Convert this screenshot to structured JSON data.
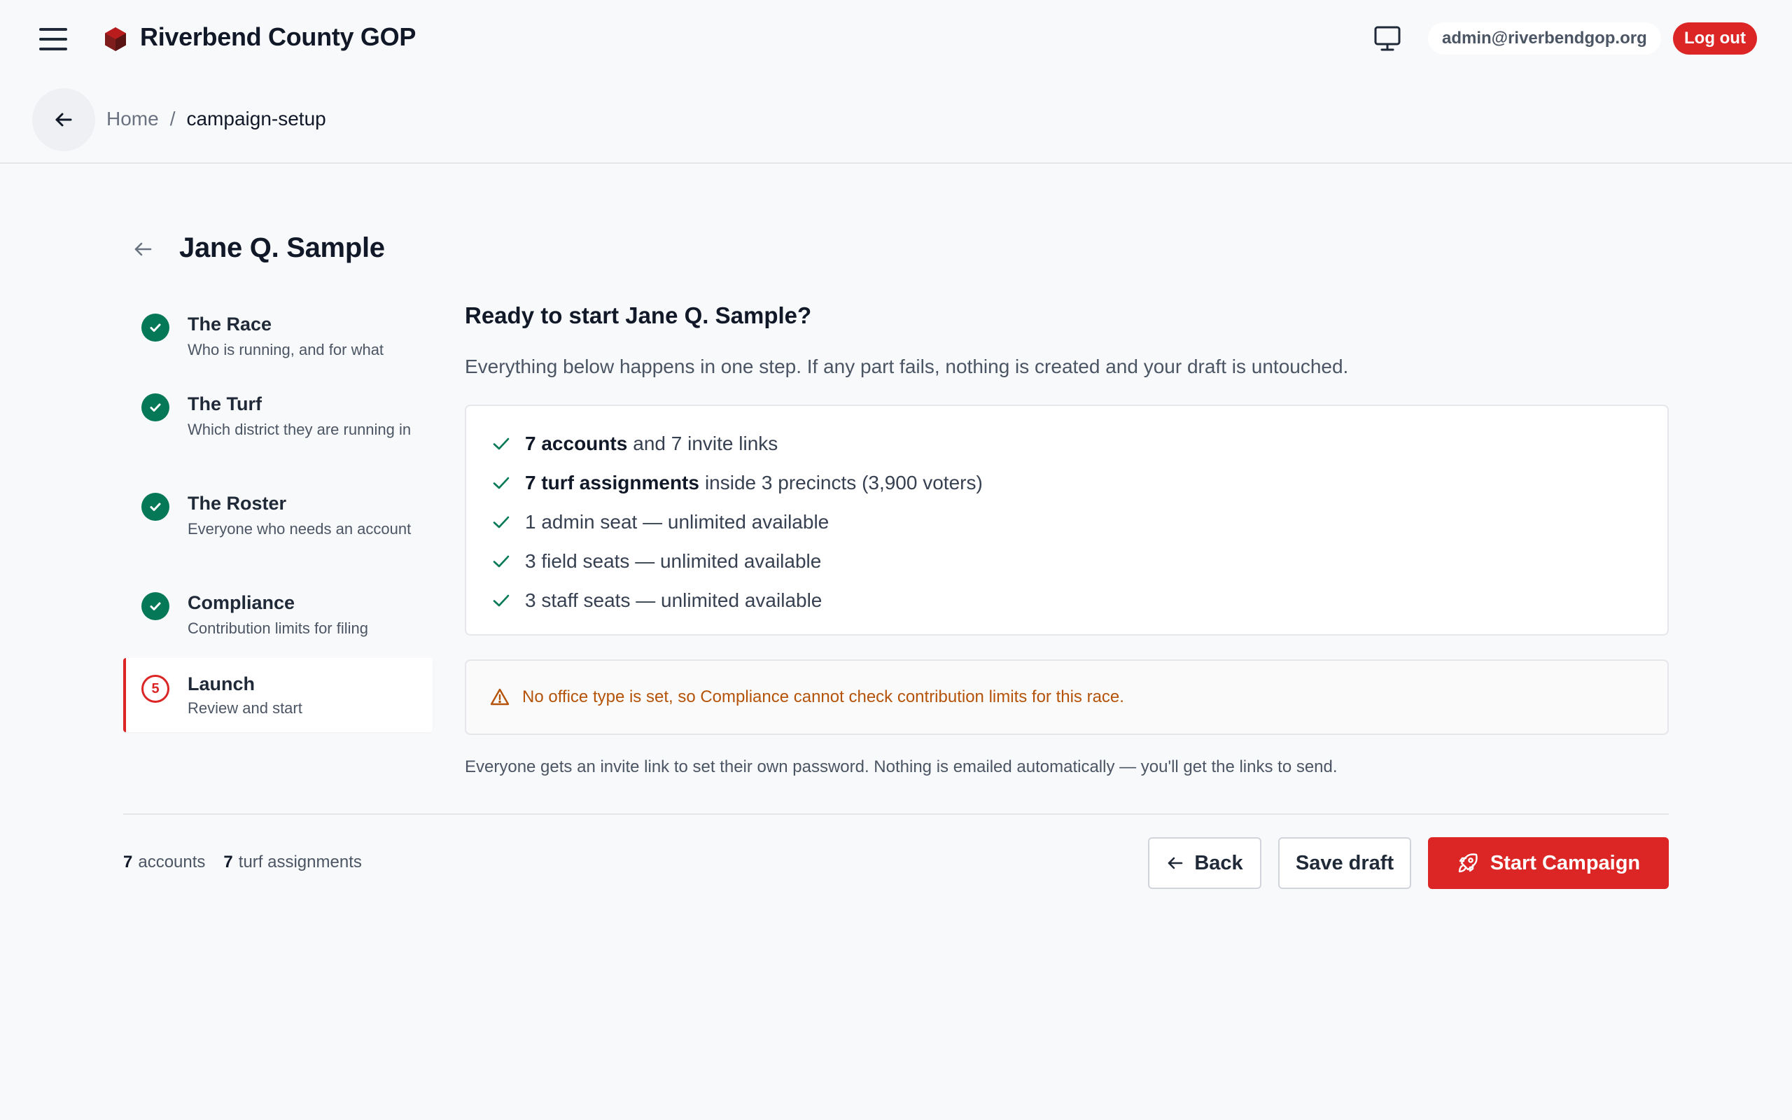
{
  "header": {
    "brand": "Riverbend County GOP",
    "user_email": "admin@riverbendgop.org",
    "logout_label": "Log out",
    "icons": [
      "menu-icon",
      "logo-icon",
      "monitor-icon"
    ]
  },
  "breadcrumb": {
    "home": "Home",
    "separator": "/",
    "current": "campaign-setup"
  },
  "page": {
    "title": "Jane Q. Sample"
  },
  "steps": [
    {
      "number": "1",
      "title": "The Race",
      "subtitle": "Who is running, and for what",
      "status": "complete"
    },
    {
      "number": "2",
      "title": "The Turf",
      "subtitle": "Which district they are running in",
      "status": "complete"
    },
    {
      "number": "3",
      "title": "The Roster",
      "subtitle": "Everyone who needs an account",
      "status": "complete"
    },
    {
      "number": "4",
      "title": "Compliance",
      "subtitle": "Contribution limits for filing",
      "status": "complete"
    },
    {
      "number": "5",
      "title": "Launch",
      "subtitle": "Review and start",
      "status": "current"
    }
  ],
  "launch": {
    "heading": "Ready to start Jane Q. Sample?",
    "lead": "Everything below happens in one step. If any part fails, nothing is created and your draft is untouched.",
    "summary": [
      {
        "bold": "7 accounts",
        "text": "and 7 invite links"
      },
      {
        "bold": "7 turf assignments",
        "text": "inside 3 precincts (3,900 voters)"
      },
      {
        "bold": "",
        "text": "1 admin seat — unlimited available"
      },
      {
        "bold": "",
        "text": "3 field seats — unlimited available"
      },
      {
        "bold": "",
        "text": "3 staff seats — unlimited available"
      }
    ],
    "warning": "No office type is set, so Compliance cannot check contribution limits for this race.",
    "footnote": "Everyone gets an invite link to set their own password. Nothing is emailed automatically — you'll get the links to send."
  },
  "footer": {
    "accounts_count": "7",
    "accounts_label": "accounts",
    "turf_count": "7",
    "turf_label": "turf assignments",
    "back_label": "Back",
    "save_label": "Save draft",
    "start_label": "Start Campaign"
  },
  "colors": {
    "brand_red": "#dc2626",
    "complete_green": "#047857",
    "warning_amber": "#b45309"
  }
}
